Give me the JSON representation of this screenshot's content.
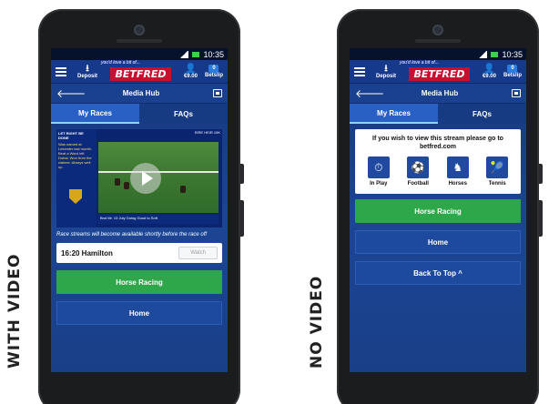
{
  "labels": {
    "left": "WITH VIDEO",
    "right": "NO VIDEO"
  },
  "status": {
    "time": "10:35"
  },
  "nav": {
    "deposit": "Deposit",
    "tagline": "you'd love a bit of...",
    "brand": "BETFRED",
    "balance": "€9.00",
    "betslip": "Betslip",
    "betslip_count": "0"
  },
  "hub": {
    "title": "Media Hub"
  },
  "tabs": {
    "my_races": "My Races",
    "faqs": "FAQs"
  },
  "video": {
    "side_heading": "LET RIGHT BE DONE",
    "side_text": "Was named at Leicester last month. Beat a Ward left Dubai. Won from the claimer. Always well up.",
    "top_text": "EIRE HEIR 10K",
    "bottom_text": "Bnd  Mr. 13 July  Going  Good to Soft"
  },
  "with_video": {
    "notice": "Race streams will become available shortly before the race off",
    "race_name": "16:20 Hamilton",
    "watch_label": "Watch",
    "cta_primary": "Horse Racing",
    "cta_secondary": "Home"
  },
  "no_video": {
    "message": "If you wish to view this stream please go to betfred.com",
    "sports": [
      "In Play",
      "Football",
      "Horses",
      "Tennis"
    ],
    "cta_primary": "Horse Racing",
    "cta_secondary": "Home",
    "cta_tertiary": "Back To Top ^"
  },
  "colors": {
    "accent_green": "#2ea64a",
    "brand_red": "#c8102e",
    "hub_blue": "#1a4190"
  }
}
